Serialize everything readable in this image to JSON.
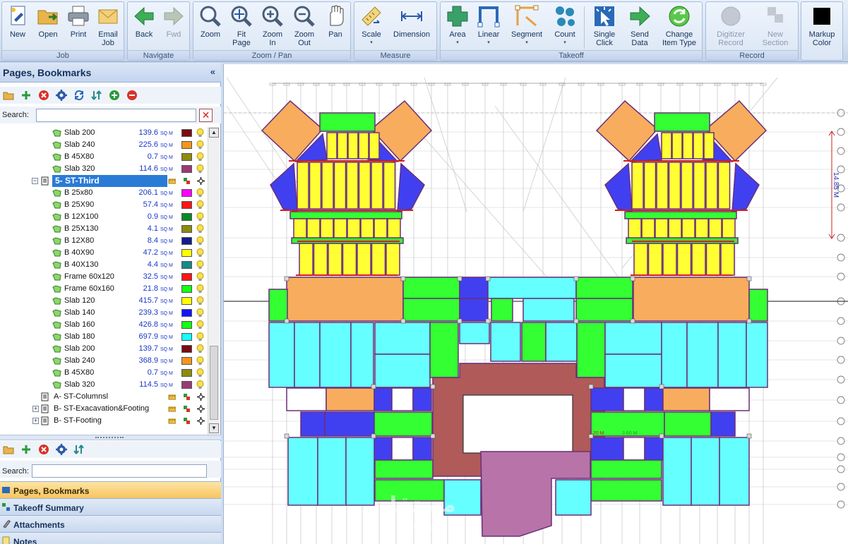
{
  "ribbon": {
    "groups": [
      {
        "title": "Job",
        "buttons": [
          {
            "label": "New",
            "icon": "new-document-icon"
          },
          {
            "label": "Open",
            "icon": "open-folder-icon"
          },
          {
            "label": "Print",
            "icon": "printer-icon"
          },
          {
            "label": "Email Job",
            "icon": "email-icon"
          }
        ]
      },
      {
        "title": "Navigate",
        "buttons": [
          {
            "label": "Back",
            "icon": "arrow-left-icon"
          },
          {
            "label": "Fwd",
            "icon": "arrow-right-icon",
            "disabled": true
          }
        ]
      },
      {
        "title": "Zoom / Pan",
        "buttons": [
          {
            "label": "Zoom",
            "icon": "magnifier-icon"
          },
          {
            "label": "Fit Page",
            "icon": "fit-page-icon"
          },
          {
            "label": "Zoom In",
            "icon": "zoom-in-icon"
          },
          {
            "label": "Zoom Out",
            "icon": "zoom-out-icon"
          },
          {
            "label": "Pan",
            "icon": "hand-icon"
          }
        ]
      },
      {
        "title": "Measure",
        "buttons": [
          {
            "label": "Scale",
            "icon": "scale-icon"
          },
          {
            "label": "Dimension",
            "icon": "dimension-icon"
          }
        ]
      },
      {
        "title": "Takeoff",
        "buttons": [
          {
            "label": "Area",
            "icon": "area-icon"
          },
          {
            "label": "Linear",
            "icon": "linear-icon"
          },
          {
            "label": "Segment",
            "icon": "segment-icon"
          },
          {
            "label": "Count",
            "icon": "count-icon"
          },
          {
            "label": "Single Click",
            "icon": "single-click-icon"
          },
          {
            "label": "Send Data",
            "icon": "send-data-icon"
          },
          {
            "label": "Change Item Type",
            "icon": "change-type-icon"
          }
        ]
      },
      {
        "title": "Record",
        "buttons": [
          {
            "label": "Digitizer Record",
            "icon": "digitizer-icon",
            "disabled": true
          },
          {
            "label": "New Section",
            "icon": "new-section-icon",
            "disabled": true
          }
        ]
      },
      {
        "title": "",
        "buttons": [
          {
            "label": "Markup Color",
            "icon": "markup-color-icon"
          }
        ]
      }
    ]
  },
  "left_panel": {
    "title": "Pages, Bookmarks",
    "collapse_glyph": "«",
    "search_label": "Search:",
    "search_value": "",
    "unit": "SQ M",
    "rows": [
      {
        "type": "item",
        "label": "Slab 200",
        "value": "139.6",
        "color": "#7a0b12"
      },
      {
        "type": "item",
        "label": "Slab 240",
        "value": "225.6",
        "color": "#f6941f"
      },
      {
        "type": "item",
        "label": "B 45X80",
        "value": "0.7",
        "color": "#8e8a0c"
      },
      {
        "type": "item",
        "label": "Slab 320",
        "value": "114.6",
        "color": "#9b3a76"
      },
      {
        "type": "group",
        "label": "5- ST-Third",
        "selected": true
      },
      {
        "type": "item",
        "label": "B 25x80",
        "value": "206.1",
        "color": "#ff00ff"
      },
      {
        "type": "item",
        "label": "B 25X90",
        "value": "57.4",
        "color": "#ff1414"
      },
      {
        "type": "item",
        "label": "B 12X100",
        "value": "0.9",
        "color": "#0c8a22"
      },
      {
        "type": "item",
        "label": "B 25X130",
        "value": "4.1",
        "color": "#8e8a0c"
      },
      {
        "type": "item",
        "label": "B 12X80",
        "value": "8.4",
        "color": "#141c8a"
      },
      {
        "type": "item",
        "label": "B 40X90",
        "value": "47.2",
        "color": "#ffff00"
      },
      {
        "type": "item",
        "label": "B 40X130",
        "value": "4.4",
        "color": "#168a8a"
      },
      {
        "type": "item",
        "label": "Frame 60x120",
        "value": "32.5",
        "color": "#ff1414"
      },
      {
        "type": "item",
        "label": "Frame 60x160",
        "value": "21.8",
        "color": "#14ff14"
      },
      {
        "type": "item",
        "label": "Slab 120",
        "value": "415.7",
        "color": "#ffff00"
      },
      {
        "type": "item",
        "label": "Slab 140",
        "value": "239.3",
        "color": "#1414ff"
      },
      {
        "type": "item",
        "label": "Slab 160",
        "value": "426.8",
        "color": "#14ff14"
      },
      {
        "type": "item",
        "label": "Slab 180",
        "value": "697.9",
        "color": "#14ffff"
      },
      {
        "type": "item",
        "label": "Slab 200",
        "value": "139.7",
        "color": "#7a0b12"
      },
      {
        "type": "item",
        "label": "Slab 240",
        "value": "368.9",
        "color": "#f6941f"
      },
      {
        "type": "item",
        "label": "B 45X80",
        "value": "0.7",
        "color": "#8e8a0c"
      },
      {
        "type": "item",
        "label": "Slab 320",
        "value": "114.5",
        "color": "#9b3a76"
      },
      {
        "type": "group",
        "label": "A- ST-Columnsl"
      },
      {
        "type": "group",
        "label": "B- ST-Exacavation&Footing",
        "expandable": true
      },
      {
        "type": "group",
        "label": "B- ST-Footing",
        "expandable": true
      }
    ],
    "lower_search_label": "Search:",
    "lower_search_value": "",
    "nav_buttons": [
      {
        "label": "Pages, Bookmarks",
        "active": true,
        "icon": "bookmark-icon"
      },
      {
        "label": "Takeoff Summary",
        "icon": "summary-icon"
      },
      {
        "label": "Attachments",
        "icon": "paperclip-icon"
      },
      {
        "label": "Notes",
        "icon": "notes-icon"
      }
    ]
  },
  "drawing": {
    "dimension_vertical": "14.85 M",
    "dimension_small_1": "1.20 M",
    "dimension_small_2": "3.60 M",
    "watermark": "مستقل",
    "watermark_sub": "mostaql.com",
    "colors": {
      "orange": "#f7ad5d",
      "yellow": "#ffff33",
      "blue": "#4040f0",
      "green": "#33ff33",
      "cyan": "#66ffff",
      "maroon": "#b05a5a",
      "purple": "#b873a8",
      "outline": "#6a2f78"
    }
  }
}
